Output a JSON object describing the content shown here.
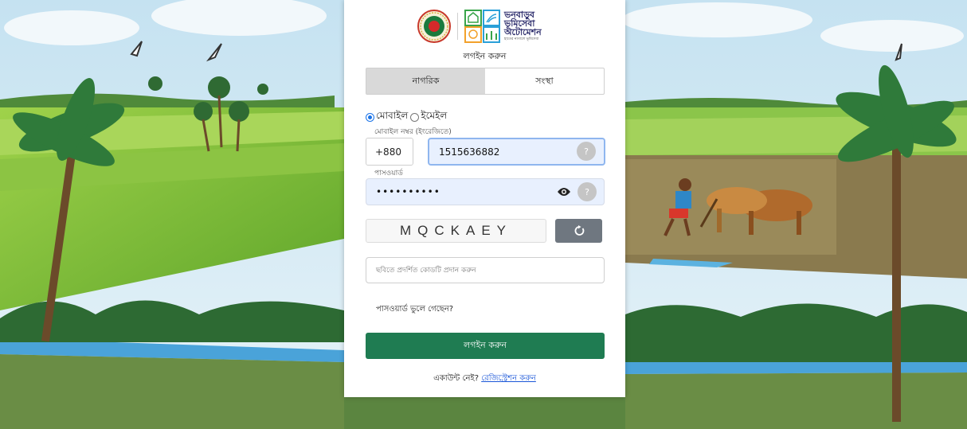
{
  "logo": {
    "line1": "ভনবাড়ুব",
    "line2": "ভূমিসেবা",
    "line3": "অটোমেশন",
    "tagline": "হাতের নাগালে ভূমিসেবা"
  },
  "card_title": "লগইন করুন",
  "tabs": [
    {
      "label": "নাগরিক",
      "active": true
    },
    {
      "label": "সংস্থা",
      "active": false
    }
  ],
  "login_method": {
    "options": [
      {
        "label": "মোবাইল",
        "checked": true
      },
      {
        "label": "ইমেইল",
        "checked": false
      }
    ]
  },
  "mobile": {
    "label": "মোবাইল নম্বর (ইংরেজিতে)",
    "country_code": "+880",
    "value": "1515636882",
    "help": "?"
  },
  "password": {
    "label": "পাসওয়ার্ড",
    "masked_value": "••••••••••",
    "help": "?"
  },
  "captcha": {
    "code": "MQCKAEY",
    "input_placeholder": "ছবিতে প্রদর্শিত কোডটি প্রদান করুন"
  },
  "forgot_password": "পাসওয়ার্ড ভুলে গেছেন?",
  "login_button": "লগইন করুন",
  "register": {
    "prompt": "একাউন্ট নেই?",
    "link": "রেজিস্ট্রেশন করুন"
  },
  "colors": {
    "primary_green": "#1f7c52",
    "link_blue": "#1a56d8",
    "refresh_gray": "#6f7780"
  },
  "icons": [
    "bangladesh-govt-seal-icon",
    "land-service-logo-icon",
    "eye-icon",
    "refresh-icon",
    "help-icon"
  ]
}
